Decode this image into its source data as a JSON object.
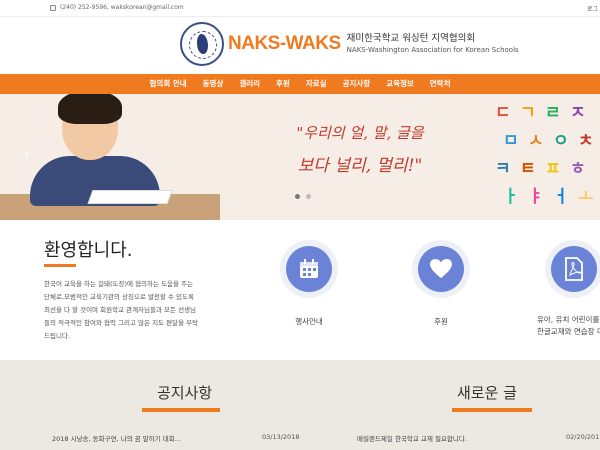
{
  "topbar": {
    "contact": "(240) 252-9596, wakskorean@gmail.com",
    "login": "로그"
  },
  "header": {
    "brand": "NAKS-WAKS",
    "title_ko": "재미한국학교 워싱턴 지역협의회",
    "title_en": "NAKS-Washington Association for Korean Schools"
  },
  "nav": {
    "items": [
      "협의회 안내",
      "동영상",
      "갤러리",
      "후원",
      "자료실",
      "공지사항",
      "교육정보",
      "연락처"
    ]
  },
  "hero": {
    "slogan_line1": "\"우리의 얼, 말, 글을",
    "slogan_line2": "보다 널리, 멀리!\"",
    "letters": [
      "ㄷ",
      "ㄱ",
      "ㄹ",
      "ㅈ",
      "ㅁ",
      "ㅅ",
      "ㅇ",
      "ㅊ",
      "ㅋ",
      "ㅌ",
      "ㅍ",
      "ㅎ",
      "ㅏ",
      "ㅑ",
      "ㅓ",
      "ㅗ"
    ],
    "letter_colors": [
      "#e74c3c",
      "#f39c12",
      "#27ae60",
      "#8e44ad",
      "#3498db",
      "#e67e22",
      "#16a085",
      "#c0392b",
      "#2980b9",
      "#d35400",
      "#f1c40f",
      "#9b59b6",
      "#1abc9c",
      "#e84393",
      "#0984e3",
      "#fdcb6e"
    ]
  },
  "welcome": {
    "title": "환영합니다.",
    "lines": [
      "한국어 교육을 하는 걸돼(도장)에 협의하는 도움을 주는",
      "단체로,모범적인 교육기관의 상징으로 발전할 수 있도록",
      "최선을 다 할 것이며 회원학교 관계자님들과 모든 선생님",
      "들의 적극적인 참여와 협력 그리고 많은 지도 편달을 부탁",
      "드립니다."
    ]
  },
  "features": [
    {
      "label": "행사안내",
      "icon": "calendar-icon"
    },
    {
      "label": "후원",
      "icon": "heart-icon"
    },
    {
      "label": "유아, 유치 어린이를",
      "label2": "한글교재와 연습장 다",
      "icon": "pdf-icon"
    }
  ],
  "notices": {
    "title": "공지사항",
    "item": "2018 시낭송, 동화구연, 나의 꿈 말하기 대회...",
    "date": "03/13/2018"
  },
  "new_posts": {
    "title": "새로운 글",
    "item": "메릴랜드제일 한국학교 교재 필요합니다.",
    "date": "02/20/201"
  },
  "colors": {
    "accent": "#f07a1f",
    "icon_blue": "#6b83d6"
  }
}
